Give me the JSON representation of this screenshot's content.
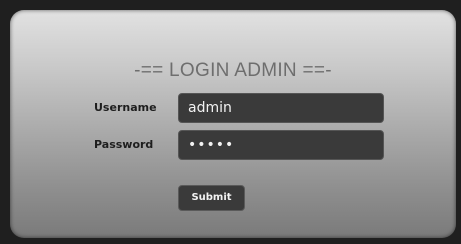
{
  "login": {
    "title": "-== LOGIN ADMIN ==-",
    "username_label": "Username",
    "password_label": "Password",
    "username_value": "admin",
    "password_value": "•••••",
    "submit_label": "Submit"
  },
  "colors": {
    "panel_top": "#e2e2e2",
    "panel_bottom": "#7a7a7a",
    "field_bg": "#3a3a3a",
    "field_text": "#f2f2f2",
    "title_text": "#6e6e6e"
  }
}
